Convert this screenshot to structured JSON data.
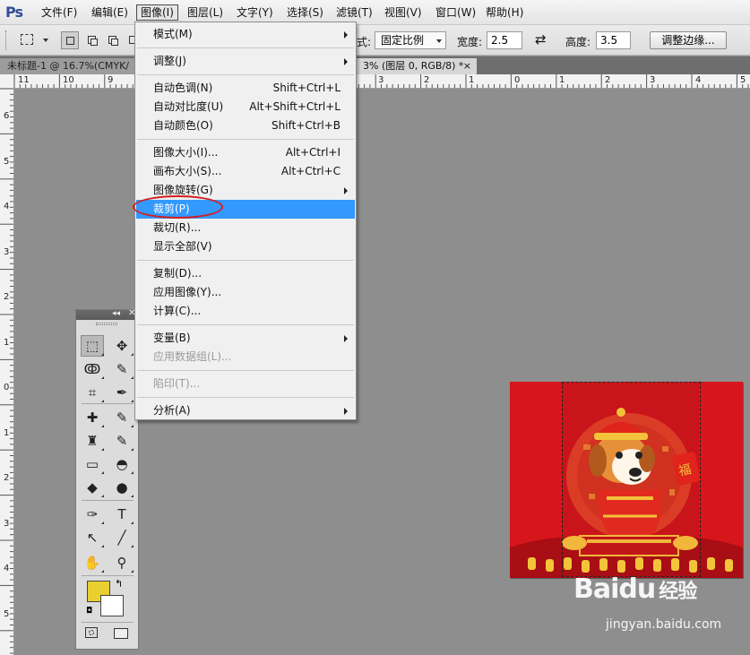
{
  "app": {
    "logo": "Ps",
    "menus": [
      "文件(F)",
      "编辑(E)",
      "图像(I)",
      "图层(L)",
      "文字(Y)",
      "选择(S)",
      "滤镜(T)",
      "视图(V)",
      "窗口(W)",
      "帮助(H)"
    ],
    "active_menu_index": 2
  },
  "options": {
    "style_label": "式:",
    "style_value": "固定比例",
    "width_label": "宽度:",
    "width_value": "2.5",
    "swap_icon": "swap-arrows-icon",
    "height_label": "高度:",
    "height_value": "3.5",
    "refine_edge_button": "调整边缘..."
  },
  "tabs": {
    "inactive": "未标题-1 @ 16.7%(CMYK/",
    "active": "3% (图层 0, RGB/8) *",
    "close": "×"
  },
  "rulers": {
    "top": [
      "11",
      "10",
      "9",
      "3",
      "2",
      "1",
      "0",
      "1",
      "2",
      "3",
      "4",
      "5"
    ],
    "left": [
      "6",
      "5",
      "4",
      "3",
      "2",
      "1",
      "0",
      "1",
      "2",
      "3",
      "4",
      "5"
    ]
  },
  "image_menu": {
    "items": [
      {
        "label": "模式(M)",
        "shortcut": "",
        "submenu": true,
        "disabled": false,
        "highlighted": false
      },
      {
        "sep": true
      },
      {
        "label": "调整(J)",
        "shortcut": "",
        "submenu": true,
        "disabled": false,
        "highlighted": false
      },
      {
        "sep": true
      },
      {
        "label": "自动色调(N)",
        "shortcut": "Shift+Ctrl+L",
        "submenu": false,
        "disabled": false,
        "highlighted": false
      },
      {
        "label": "自动对比度(U)",
        "shortcut": "Alt+Shift+Ctrl+L",
        "submenu": false,
        "disabled": false,
        "highlighted": false
      },
      {
        "label": "自动颜色(O)",
        "shortcut": "Shift+Ctrl+B",
        "submenu": false,
        "disabled": false,
        "highlighted": false
      },
      {
        "sep": true
      },
      {
        "label": "图像大小(I)...",
        "shortcut": "Alt+Ctrl+I",
        "submenu": false,
        "disabled": false,
        "highlighted": false
      },
      {
        "label": "画布大小(S)...",
        "shortcut": "Alt+Ctrl+C",
        "submenu": false,
        "disabled": false,
        "highlighted": false
      },
      {
        "label": "图像旋转(G)",
        "shortcut": "",
        "submenu": true,
        "disabled": false,
        "highlighted": false
      },
      {
        "label": "裁剪(P)",
        "shortcut": "",
        "submenu": false,
        "disabled": false,
        "highlighted": true
      },
      {
        "label": "裁切(R)...",
        "shortcut": "",
        "submenu": false,
        "disabled": false,
        "highlighted": false
      },
      {
        "label": "显示全部(V)",
        "shortcut": "",
        "submenu": false,
        "disabled": false,
        "highlighted": false
      },
      {
        "sep": true
      },
      {
        "label": "复制(D)...",
        "shortcut": "",
        "submenu": false,
        "disabled": false,
        "highlighted": false
      },
      {
        "label": "应用图像(Y)...",
        "shortcut": "",
        "submenu": false,
        "disabled": false,
        "highlighted": false
      },
      {
        "label": "计算(C)...",
        "shortcut": "",
        "submenu": false,
        "disabled": false,
        "highlighted": false
      },
      {
        "sep": true
      },
      {
        "label": "变量(B)",
        "shortcut": "",
        "submenu": true,
        "disabled": false,
        "highlighted": false
      },
      {
        "label": "应用数据组(L)...",
        "shortcut": "",
        "submenu": false,
        "disabled": true,
        "highlighted": false
      },
      {
        "sep": true
      },
      {
        "label": "陷印(T)...",
        "shortcut": "",
        "submenu": false,
        "disabled": true,
        "highlighted": false
      },
      {
        "sep": true
      },
      {
        "label": "分析(A)",
        "shortcut": "",
        "submenu": true,
        "disabled": false,
        "highlighted": false
      }
    ]
  },
  "tools": {
    "rows": [
      [
        "rect-marquee-icon",
        "move-icon"
      ],
      [
        "lasso-icon",
        "quick-select-icon"
      ],
      [
        "crop-icon",
        "eyedropper-icon"
      ],
      [
        "healing-brush-icon",
        "brush-icon"
      ],
      [
        "clone-stamp-icon",
        "history-brush-icon"
      ],
      [
        "eraser-icon",
        "paint-bucket-icon"
      ],
      [
        "blur-icon",
        "dodge-icon"
      ],
      [
        "pen-icon",
        "type-icon"
      ],
      [
        "path-select-icon",
        "line-icon"
      ],
      [
        "hand-icon",
        "zoom-icon"
      ]
    ],
    "glyphs": [
      "⬚",
      "✥",
      "ↂ",
      "✎",
      "⌗",
      "✒",
      "✚",
      "✎",
      "♜",
      "✎",
      "▭",
      "◓",
      "◆",
      "●",
      "✑",
      "T",
      "↖",
      "╱",
      "✋",
      "⚲"
    ],
    "fg_color": "#e8d030",
    "bg_color": "#ffffff"
  },
  "canvas": {
    "fortune_char": "福"
  },
  "watermark": {
    "brand": "Baidu",
    "brand_suffix": "经验",
    "url": "jingyan.baidu.com"
  }
}
